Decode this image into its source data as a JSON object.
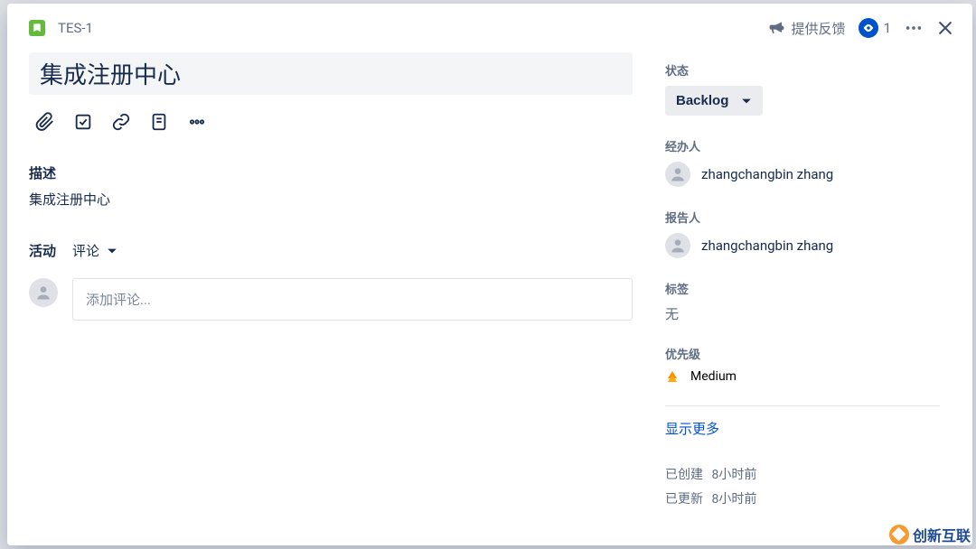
{
  "header": {
    "issue_key": "TES-1",
    "feedback_label": "提供反馈",
    "watch_count": "1"
  },
  "main": {
    "title": "集成注册中心",
    "desc_label": "描述",
    "desc_text": "集成注册中心",
    "activity_label": "活动",
    "active_tab": "评论",
    "comment_placeholder": "添加评论..."
  },
  "side": {
    "status_label": "状态",
    "status_value": "Backlog",
    "assignee_label": "经办人",
    "assignee_value": "zhangchangbin zhang",
    "reporter_label": "报告人",
    "reporter_value": "zhangchangbin zhang",
    "tags_label": "标签",
    "tags_value": "无",
    "priority_label": "优先级",
    "priority_value": "Medium",
    "show_more": "显示更多",
    "created_label": "已创建",
    "created_value": "8小时前",
    "updated_label": "已更新",
    "updated_value": "8小时前"
  },
  "watermark": "创新互联"
}
